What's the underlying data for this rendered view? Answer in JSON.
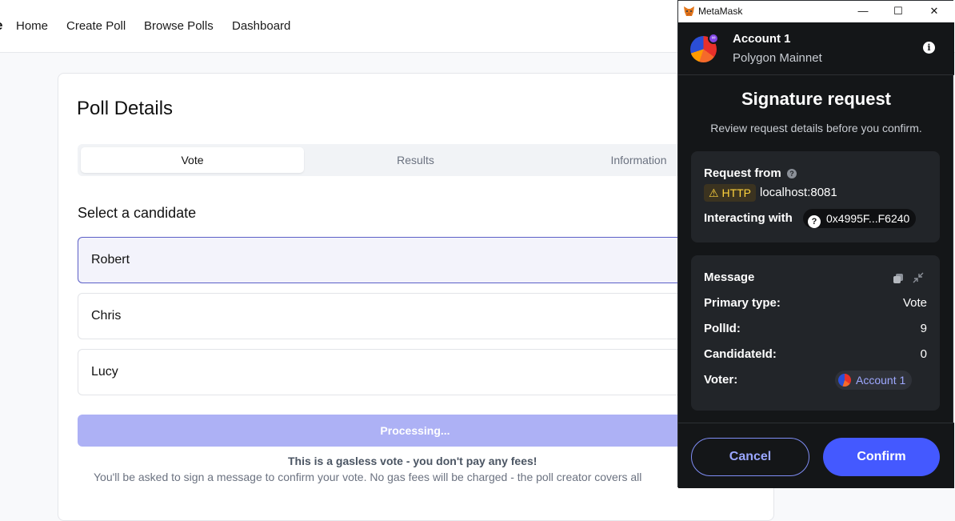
{
  "nav": {
    "logo_fragment": "e",
    "links": [
      "Home",
      "Create Poll",
      "Browse Polls",
      "Dashboard"
    ]
  },
  "poll": {
    "title": "Poll Details",
    "tabs": [
      "Vote",
      "Results",
      "Information"
    ],
    "active_tab": "Vote",
    "select_label": "Select a candidate",
    "candidates": [
      "Robert",
      "Chris",
      "Lucy"
    ],
    "selected_candidate": "Robert",
    "processing_label": "Processing...",
    "gasless_note": "This is a gasless vote - you don't pay any fees!",
    "sign_note": "You'll be asked to sign a message to confirm your vote. No gas fees will be charged - the poll creator covers all"
  },
  "metamask": {
    "window_title": "MetaMask",
    "window_controls": [
      "—",
      "☐",
      "✕"
    ],
    "account_name": "Account 1",
    "network": "Polygon Mainnet",
    "heading": "Signature request",
    "subheading": "Review request details before you confirm.",
    "request_from_label": "Request from",
    "http_badge": "HTTP",
    "origin": "localhost:8081",
    "interacting_label": "Interacting with",
    "contract_address": "0x4995F...F6240",
    "message_label": "Message",
    "fields": [
      {
        "label": "Primary type:",
        "value": "Vote"
      },
      {
        "label": "PollId:",
        "value": "9"
      },
      {
        "label": "CandidateId:",
        "value": "0"
      },
      {
        "label": "Voter:",
        "value": "Account 1"
      }
    ],
    "cancel_label": "Cancel",
    "confirm_label": "Confirm",
    "colors": {
      "accent": "#4459ff",
      "panel_bg": "#141618",
      "card_bg": "#222529",
      "warning": "#ffd33d"
    }
  }
}
